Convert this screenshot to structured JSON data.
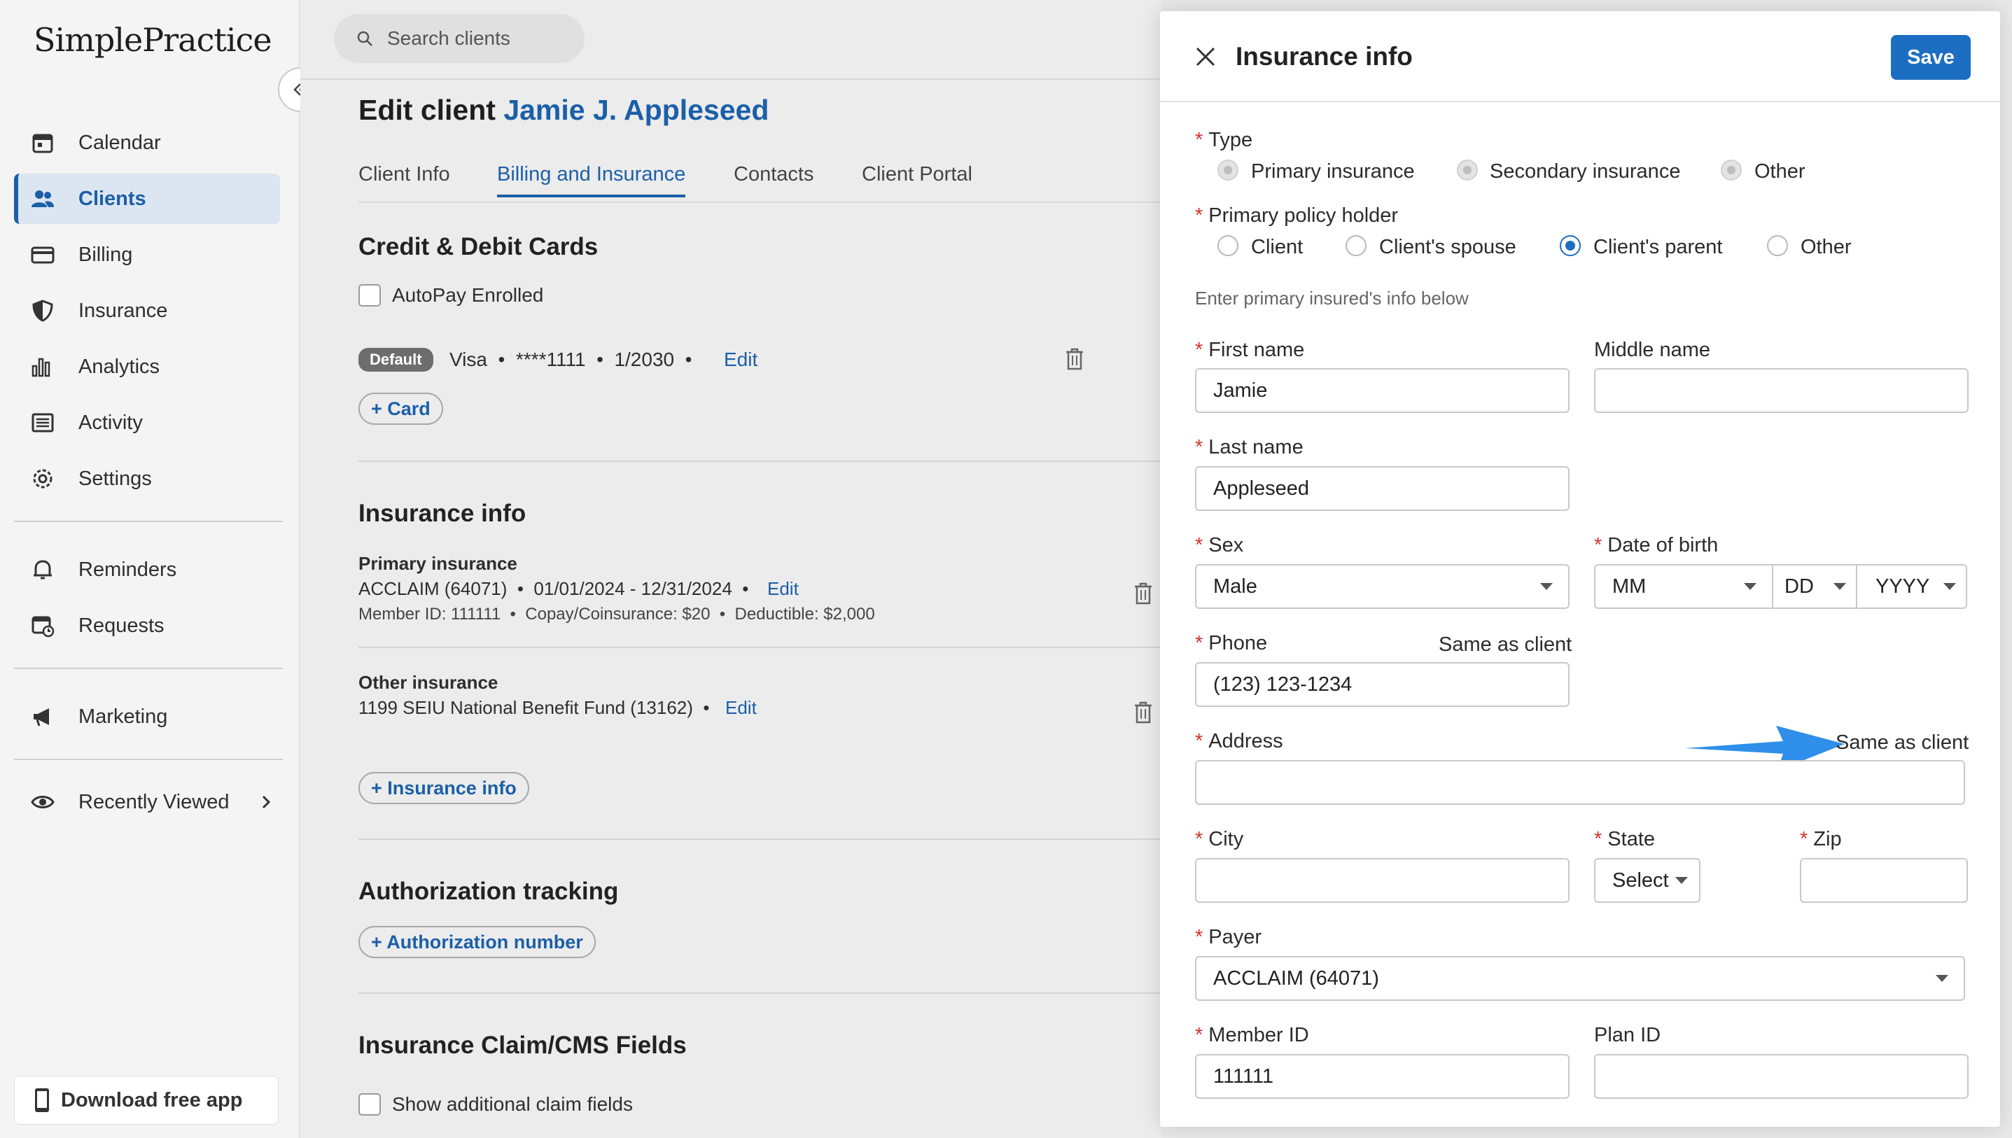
{
  "app": {
    "logo": "SimplePractice"
  },
  "sidebar": {
    "items": [
      {
        "label": "Calendar",
        "icon": "calendar-icon"
      },
      {
        "label": "Clients",
        "icon": "clients-icon"
      },
      {
        "label": "Billing",
        "icon": "credit-card-icon"
      },
      {
        "label": "Insurance",
        "icon": "shield-icon"
      },
      {
        "label": "Analytics",
        "icon": "bar-chart-icon"
      },
      {
        "label": "Activity",
        "icon": "list-icon"
      },
      {
        "label": "Settings",
        "icon": "gear-icon"
      },
      {
        "label": "Reminders",
        "icon": "bell-icon"
      },
      {
        "label": "Requests",
        "icon": "calendar-request-icon"
      },
      {
        "label": "Marketing",
        "icon": "megaphone-icon"
      },
      {
        "label": "Recently Viewed",
        "icon": "eye-icon"
      }
    ],
    "download_label": "Download free app"
  },
  "main": {
    "search_placeholder": "Search clients",
    "title_prefix": "Edit client",
    "client_name": "Jamie J. Appleseed",
    "tabs": [
      "Client Info",
      "Billing and Insurance",
      "Contacts",
      "Client Portal"
    ],
    "cards": {
      "heading": "Credit & Debit Cards",
      "autopay": "AutoPay Enrolled",
      "default_badge": "Default",
      "card_line": "Visa  •  ****1111  •  1/2030  •",
      "edit": "Edit",
      "add_card": "+ Card"
    },
    "insurance": {
      "heading": "Insurance info",
      "primary_title": "Primary insurance",
      "primary_line": "ACCLAIM (64071)  •  01/01/2024 - 12/31/2024  •",
      "primary_details": "Member ID: 111111  •  Copay/Coinsurance: $20  •  Deductible: $2,000",
      "other_title": "Other insurance",
      "other_line": "1199 SEIU National Benefit Fund (13162)  •",
      "edit": "Edit",
      "add": "+ Insurance info"
    },
    "authorization": {
      "heading": "Authorization tracking",
      "add": "+ Authorization number"
    },
    "claims": {
      "heading": "Insurance Claim/CMS Fields",
      "checkbox": "Show additional claim fields"
    }
  },
  "panel": {
    "title": "Insurance info",
    "save": "Save",
    "type_label": "Type",
    "type_options": [
      "Primary insurance",
      "Secondary insurance",
      "Other"
    ],
    "holder_label": "Primary policy holder",
    "holder_options": [
      "Client",
      "Client's spouse",
      "Client's parent",
      "Other"
    ],
    "holder_selected": "Client's parent",
    "hint": "Enter primary insured's info below",
    "first_name_label": "First name",
    "first_name": "Jamie",
    "middle_name_label": "Middle name",
    "middle_name": "",
    "last_name_label": "Last name",
    "last_name": "Appleseed",
    "sex_label": "Sex",
    "sex": "Male",
    "dob_label": "Date of birth",
    "dob_mm": "MM",
    "dob_dd": "DD",
    "dob_yyyy": "YYYY",
    "phone_label": "Phone",
    "phone": "(123) 123-1234",
    "same_as_client": "Same as client",
    "address_label": "Address",
    "address": "",
    "city_label": "City",
    "state_label": "State",
    "state": "Select",
    "zip_label": "Zip",
    "payer_label": "Payer",
    "payer": "ACCLAIM (64071)",
    "member_id_label": "Member ID",
    "member_id": "111111",
    "plan_id_label": "Plan ID",
    "plan_id": ""
  },
  "colors": {
    "accent": "#1b5fa8",
    "required": "#d6332e",
    "annotation_arrow": "#2f8fea"
  }
}
